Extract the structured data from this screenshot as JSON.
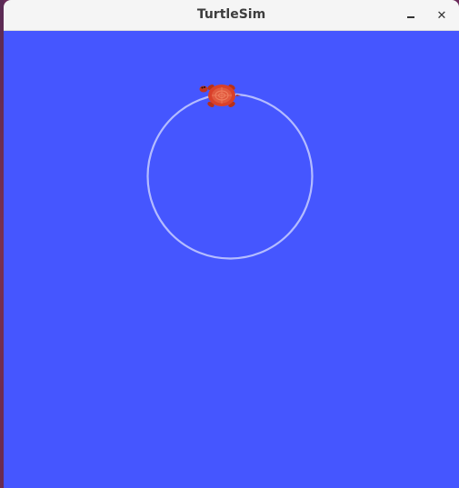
{
  "window": {
    "title": "TurtleSim",
    "controls": {
      "minimize_icon": "minimize-icon",
      "close_icon": "close-icon",
      "close_glyph": "✕"
    }
  },
  "canvas": {
    "background_color": "#4556ff",
    "trail_color": "#b4bcff",
    "turtle_colors": {
      "shell": "#d9402a",
      "shell_pattern": "#f08060",
      "limbs": "#b83018"
    }
  }
}
